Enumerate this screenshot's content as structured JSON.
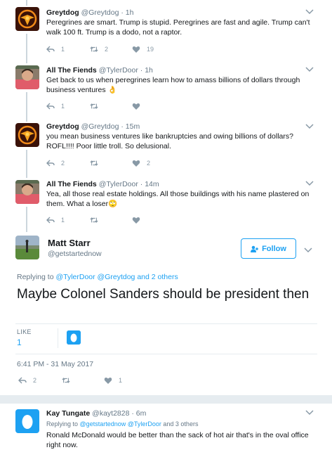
{
  "replies": [
    {
      "name": "Greytdog",
      "handle": "@Greytdog",
      "dot": "·",
      "time": "1h",
      "text": "Peregrines are smart. Trump is stupid. Peregrines are fast and agile. Trump can't walk 100 ft.  Trump is a dodo, not a raptor.",
      "reply_count": "1",
      "retweet_count": "2",
      "like_count": "19"
    },
    {
      "name": "All The Fiends",
      "handle": "@TylerDoor",
      "dot": "·",
      "time": "1h",
      "text": "Get back to us when peregrines learn how to amass billions of dollars through business ventures 👌",
      "reply_count": "1",
      "retweet_count": "",
      "like_count": ""
    },
    {
      "name": "Greytdog",
      "handle": "@Greytdog",
      "dot": "·",
      "time": "15m",
      "text": "you mean business ventures like bankruptcies and owing billions of dollars? ROFL!!!! Poor little troll. So delusional.",
      "reply_count": "2",
      "retweet_count": "",
      "like_count": "2"
    },
    {
      "name": "All The Fiends",
      "handle": "@TylerDoor",
      "dot": "·",
      "time": "14m",
      "text": "Yea, all those real estate holdings. All those buildings with his name plastered on them. What a loser🙄",
      "reply_count": "1",
      "retweet_count": "",
      "like_count": ""
    }
  ],
  "main": {
    "name": "Matt Starr",
    "handle": "@getstartednow",
    "follow_label": "Follow",
    "replying_prefix": "Replying to",
    "replying_user1": "@TylerDoor",
    "replying_user2": "@Greytdog",
    "replying_suffix": "and 2 others",
    "text": "Maybe Colonel Sanders should be president then",
    "like_label": "LIKE",
    "like_value": "1",
    "timestamp": "6:41 PM - 31 May 2017",
    "reply_count": "2",
    "retweet_count": "",
    "like_count": "1"
  },
  "bottom_reply": {
    "name": "Kay Tungate",
    "handle": "@kayt2828",
    "dot": "·",
    "time": "6m",
    "replying_prefix": "Replying to",
    "replying_user1": "@getstartednow",
    "replying_user2": "@TylerDoor",
    "replying_suffix": "and 3 others",
    "text": "Ronald McDonald would be better than the sack of hot air that's in the oval office right now."
  },
  "colors": {
    "accent": "#1da1f2",
    "muted": "#657786",
    "icon": "#8899a6",
    "line": "#ccd6dd"
  }
}
